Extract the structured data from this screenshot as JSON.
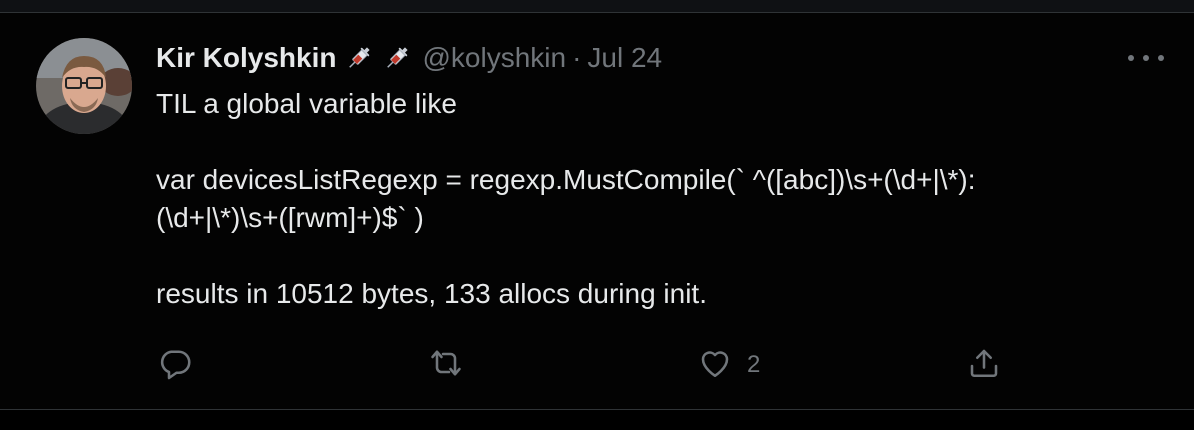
{
  "tweet": {
    "author_name": "Kir Kolyshkin",
    "author_emojis": [
      "syringe-emoji",
      "syringe-emoji"
    ],
    "handle": "@kolyshkin",
    "separator": "·",
    "date": "Jul 24",
    "body_lines": [
      "TIL a global variable like",
      "",
      "var devicesListRegexp = regexp.MustCompile(` ^([abc])\\s+(\\d+|\\*):",
      "(\\d+|\\*)\\s+([rwm]+)$` )",
      "",
      "results in 10512 bytes, 133 allocs during init."
    ],
    "actions": {
      "reply": {
        "icon": "reply-icon",
        "count": ""
      },
      "retweet": {
        "icon": "retweet-icon",
        "count": ""
      },
      "like": {
        "icon": "heart-icon",
        "count": "2"
      },
      "share": {
        "icon": "share-icon",
        "count": ""
      }
    }
  },
  "colors": {
    "background": "#000000",
    "primary_text": "#e7e9ea",
    "secondary_text": "#71767b",
    "border": "#2f3336"
  }
}
